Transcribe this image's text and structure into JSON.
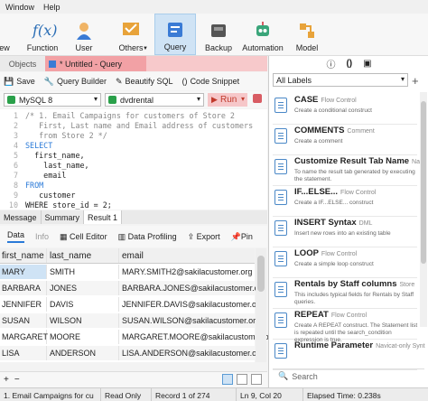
{
  "menubar": {
    "items": [
      "Window",
      "Help"
    ]
  },
  "toolbar": {
    "items": [
      {
        "label": "ew",
        "icon": "new-icon"
      },
      {
        "label": "Function",
        "icon": "function-icon"
      },
      {
        "label": "User",
        "icon": "user-icon"
      },
      {
        "label": "Others",
        "icon": "others-icon"
      },
      {
        "label": "Query",
        "icon": "query-icon",
        "active": true
      },
      {
        "label": "Backup",
        "icon": "backup-icon"
      },
      {
        "label": "Automation",
        "icon": "automation-icon"
      },
      {
        "label": "Model",
        "icon": "model-icon"
      }
    ]
  },
  "tabs": {
    "objects": "Objects",
    "query_title": "* Untitled - Query"
  },
  "query_toolbar": {
    "save": "Save",
    "builder": "Query Builder",
    "beautify": "Beautify SQL",
    "snippet": "Code Snippet"
  },
  "connection": {
    "server": "MySQL 8",
    "database": "dvdrental",
    "run": "Run"
  },
  "editor": {
    "lines": [
      {
        "n": "1",
        "t": "/* 1. Email Campaigns for customers of Store 2",
        "cls": "cm"
      },
      {
        "n": "2",
        "t": "   First, Last name and Email address of customers",
        "cls": "cm"
      },
      {
        "n": "3",
        "t": "   from Store 2 */",
        "cls": "cm"
      },
      {
        "n": "4",
        "t": "SELECT",
        "cls": "kw"
      },
      {
        "n": "5",
        "t": "  first_name,",
        "cls": ""
      },
      {
        "n": "6",
        "t": "    last_name,",
        "cls": ""
      },
      {
        "n": "7",
        "t": "    email",
        "cls": ""
      },
      {
        "n": "8",
        "t": "FROM",
        "cls": "kw"
      },
      {
        "n": "9",
        "t": "   customer",
        "cls": ""
      },
      {
        "n": "10",
        "t": "WHERE store_id = 2;",
        "cls": ""
      }
    ]
  },
  "result_tabs": [
    "Message",
    "Summary",
    "Result 1"
  ],
  "data_toolbar": {
    "data": "Data",
    "info": "Info",
    "cell_editor": "Cell Editor",
    "profiling": "Data Profiling",
    "export": "Export",
    "pin": "Pin"
  },
  "grid": {
    "headers": [
      "first_name",
      "last_name",
      "email"
    ],
    "rows": [
      [
        "MARY",
        "SMITH",
        "MARY.SMITH2@sakilacustomer.org"
      ],
      [
        "BARBARA",
        "JONES",
        "BARBARA.JONES@sakilacustomer.org"
      ],
      [
        "JENNIFER",
        "DAVIS",
        "JENNIFER.DAVIS@sakilacustomer.org"
      ],
      [
        "SUSAN",
        "WILSON",
        "SUSAN.WILSON@sakilacustomer.org"
      ],
      [
        "MARGARET",
        "MOORE",
        "MARGARET.MOORE@sakilacustomer.org"
      ],
      [
        "LISA",
        "ANDERSON",
        "LISA.ANDERSON@sakilacustomer.org"
      ]
    ]
  },
  "gridfoot": {
    "add": "+",
    "remove": "−"
  },
  "status": {
    "query": "1. Email Campaigns for cu",
    "mode": "Read Only",
    "record": "Record 1 of 274",
    "position": "Ln 9, Col 20",
    "elapsed": "Elapsed Time: 0.238s"
  },
  "snippets": {
    "filter": "All Labels",
    "items": [
      {
        "title": "CASE",
        "cat": "Flow Control",
        "desc": "Create a conditional construct"
      },
      {
        "title": "COMMENTS",
        "cat": "Comment",
        "desc": "Create a comment"
      },
      {
        "title": "Customize Result Tab Name",
        "cat": "Nav",
        "desc": "To name the result tab generated by executing the statement."
      },
      {
        "title": "IF...ELSE...",
        "cat": "Flow Control",
        "desc": "Create a IF...ELSE... construct"
      },
      {
        "title": "INSERT Syntax",
        "cat": "DML",
        "desc": "Insert new rows into an existing table"
      },
      {
        "title": "LOOP",
        "cat": "Flow Control",
        "desc": "Create a simple loop construct"
      },
      {
        "title": "Rentals by Staff columns",
        "cat": "Store",
        "desc": "This includes typical fields for Rentals by Staff queries."
      },
      {
        "title": "REPEAT",
        "cat": "Flow Control",
        "desc": "Create A REPEAT construct. The Statement list is repeated until the search_condition expression is true."
      },
      {
        "title": "Runtime Parameter",
        "cat": "Navicat-only Synt",
        "desc": ""
      }
    ],
    "search": "Search"
  }
}
